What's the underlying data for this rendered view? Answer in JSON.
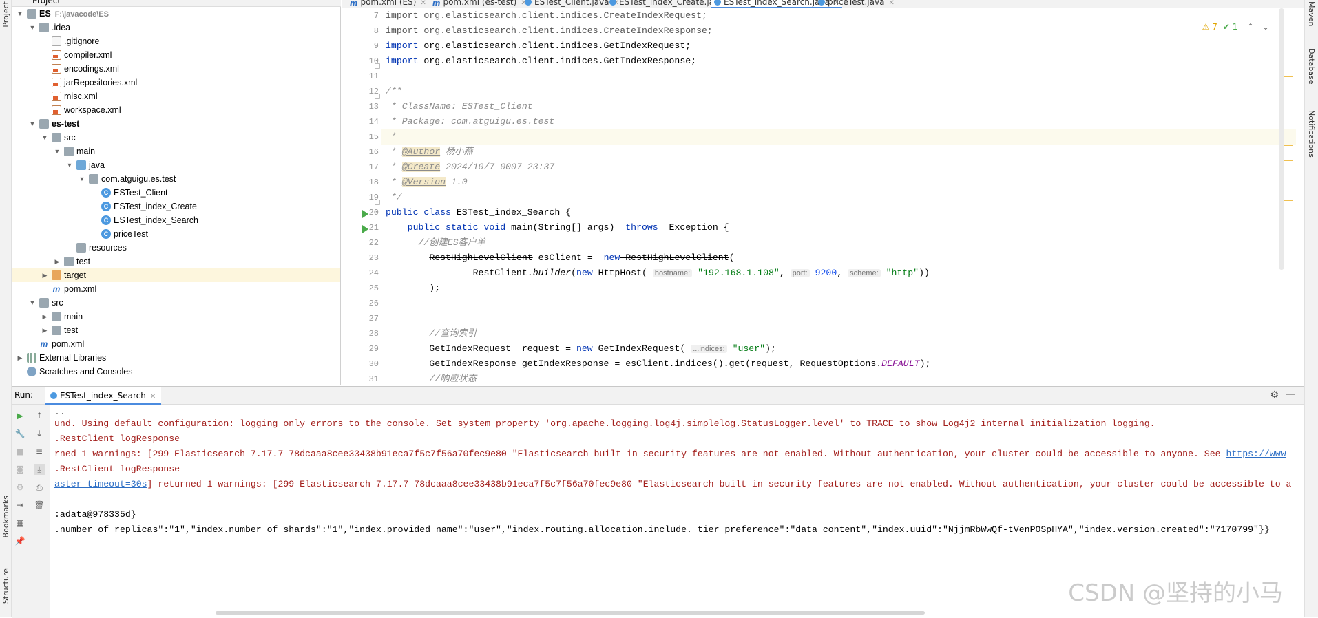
{
  "left_stripe": {
    "project": "Project",
    "bookmarks": "Bookmarks",
    "structure": "Structure"
  },
  "right_stripe": {
    "maven": "Maven",
    "database": "Database",
    "notifications": "Notifications"
  },
  "project_panel": {
    "title": "Project"
  },
  "tree": [
    {
      "label": "ES",
      "path": "F:\\javacode\\ES",
      "icon": "folder",
      "indent": 0,
      "arrow": "open",
      "bold": true
    },
    {
      "label": ".idea",
      "icon": "folder",
      "indent": 1,
      "arrow": "open"
    },
    {
      "label": ".gitignore",
      "icon": "git",
      "indent": 2
    },
    {
      "label": "compiler.xml",
      "icon": "xml",
      "indent": 2
    },
    {
      "label": "encodings.xml",
      "icon": "xml",
      "indent": 2
    },
    {
      "label": "jarRepositories.xml",
      "icon": "xml",
      "indent": 2
    },
    {
      "label": "misc.xml",
      "icon": "xml",
      "indent": 2
    },
    {
      "label": "workspace.xml",
      "icon": "xml",
      "indent": 2
    },
    {
      "label": "es-test",
      "icon": "folder",
      "indent": 1,
      "arrow": "open",
      "bold": true
    },
    {
      "label": "src",
      "icon": "folder",
      "indent": 2,
      "arrow": "open"
    },
    {
      "label": "main",
      "icon": "folder",
      "indent": 3,
      "arrow": "open"
    },
    {
      "label": "java",
      "icon": "folder-blue",
      "indent": 4,
      "arrow": "open"
    },
    {
      "label": "com.atguigu.es.test",
      "icon": "folder",
      "indent": 5,
      "arrow": "open"
    },
    {
      "label": "ESTest_Client",
      "icon": "class",
      "indent": 6
    },
    {
      "label": "ESTest_index_Create",
      "icon": "class",
      "indent": 6
    },
    {
      "label": "ESTest_index_Search",
      "icon": "class",
      "indent": 6
    },
    {
      "label": "priceTest",
      "icon": "class",
      "indent": 6
    },
    {
      "label": "resources",
      "icon": "folder",
      "indent": 4
    },
    {
      "label": "test",
      "icon": "folder",
      "indent": 3,
      "arrow": "closed"
    },
    {
      "label": "target",
      "icon": "folder-orange",
      "indent": 2,
      "arrow": "closed",
      "selected": true
    },
    {
      "label": "pom.xml",
      "icon": "maven",
      "indent": 2
    },
    {
      "label": "src",
      "icon": "folder",
      "indent": 1,
      "arrow": "open"
    },
    {
      "label": "main",
      "icon": "folder",
      "indent": 2,
      "arrow": "closed"
    },
    {
      "label": "test",
      "icon": "folder",
      "indent": 2,
      "arrow": "closed"
    },
    {
      "label": "pom.xml",
      "icon": "maven",
      "indent": 1
    },
    {
      "label": "External Libraries",
      "icon": "lib",
      "indent": 0,
      "arrow": "closed"
    },
    {
      "label": "Scratches and Consoles",
      "icon": "scratch",
      "indent": 0
    }
  ],
  "tabs": [
    {
      "label": "pom.xml (ES)",
      "icon": "m"
    },
    {
      "label": "pom.xml (es-test)",
      "icon": "m"
    },
    {
      "label": "ESTest_Client.java",
      "icon": "c"
    },
    {
      "label": "ESTest_index_Create.java",
      "icon": "c"
    },
    {
      "label": "ESTest_index_Search.java",
      "icon": "c",
      "active": true
    },
    {
      "label": "priceTest.java",
      "icon": "c"
    }
  ],
  "inspections": {
    "warnings": "7",
    "checks": "1"
  },
  "editor": {
    "line_numbers": [
      "7",
      "8",
      "9",
      "10",
      "11",
      "12",
      "13",
      "14",
      "15",
      "16",
      "17",
      "18",
      "19",
      "20",
      "21",
      "22",
      "23",
      "24",
      "25",
      "26",
      "27",
      "28",
      "29",
      "30",
      "31"
    ],
    "lines": {
      "l7a": "import org.elasticsearch.client.indices.CreateIndexRequest;",
      "l8a": "import org.elasticsearch.client.indices.CreateIndexResponse;",
      "l9k": "import",
      "l9a": " org.elasticsearch.client.indices.GetIndexRequest;",
      "l10k": "import",
      "l10a": " org.elasticsearch.client.indices.GetIndexResponse;",
      "l12": "/**",
      "l13": " * ClassName: ESTest_Client",
      "l14": " * Package: com.atguigu.es.test",
      "l15": " *",
      "l16a": " * ",
      "l16t": "@Author",
      "l16b": " 杨小燕",
      "l17a": " * ",
      "l17t": "@Create",
      "l17b": " 2024/10/7 0007 23:37",
      "l18a": " * ",
      "l18t": "@Version",
      "l18b": " 1.0",
      "l19": " */",
      "l20k": "public class",
      "l20a": " ESTest_index_Search {",
      "l21i": "    ",
      "l21k": "public static void",
      "l21a": " main(String[] args)  ",
      "l21t": "throws",
      "l21b": "  Exception {",
      "l22": "      //创建ES客户单",
      "l23i": "        ",
      "l23s": "RestHighLevelClient",
      "l23a": " esClient =  ",
      "l23n": "new",
      "l23s2": " RestHighLevelClient",
      "l23b": "(",
      "l24i": "                RestClient.",
      "l24m": "builder",
      "l24a": "(",
      "l24n": "new",
      "l24b": " HttpHost( ",
      "l24h1": "hostname:",
      "l24s1": " \"192.168.1.108\"",
      "l24c1": ", ",
      "l24h2": "port:",
      "l24n2": " 9200",
      "l24c2": ", ",
      "l24h3": "scheme:",
      "l24s3": " \"http\"",
      "l24e": "))",
      "l25": "        );",
      "l28": "        //查询索引",
      "l29a": "        GetIndexRequest  request = ",
      "l29n": "new",
      "l29b": " GetIndexRequest( ",
      "l29h": "...indices:",
      "l29s": " \"user\"",
      "l29e": ");",
      "l30a": "        GetIndexResponse getIndexResponse = esClient.indices().get(request, RequestOptions.",
      "l30d": "DEFAULT",
      "l30e": ");",
      "l31": "        //响应状态"
    }
  },
  "run_panel": {
    "label": "Run:",
    "tab": "ESTest_index_Search",
    "console": {
      "c0": "..",
      "c1": "und. Using default configuration: logging only errors to the console. Set system property 'org.apache.logging.log4j.simplelog.StatusLogger.level' to TRACE to show Log4j2 internal initialization logging.",
      "c2": ".RestClient logResponse",
      "c3": "rned 1 warnings: [299 Elasticsearch-7.17.7-78dcaaa8cee33438b91eca7f5c7f56a70fec9e80 \"Elasticsearch built-in security features are not enabled. Without authentication, your cluster could be accessible to anyone. See ",
      "c3link": "https://www",
      "c4": ".RestClient logResponse",
      "c5link": "aster_timeout=30s",
      "c5": "] returned 1 warnings: [299 Elasticsearch-7.17.7-78dcaaa8cee33438b91eca7f5c7f56a70fec9e80 \"Elasticsearch built-in security features are not enabled. Without authentication, your cluster could be accessible to a",
      "c6": ":adata@978335d}",
      "c7": ".number_of_replicas\":\"1\",\"index.number_of_shards\":\"1\",\"index.provided_name\":\"user\",\"index.routing.allocation.include._tier_preference\":\"data_content\",\"index.uuid\":\"NjjmRbWwQf-tVenPOSpHYA\",\"index.version.created\":\"7170799\"}}"
    }
  },
  "watermark": "CSDN @坚持的小马"
}
